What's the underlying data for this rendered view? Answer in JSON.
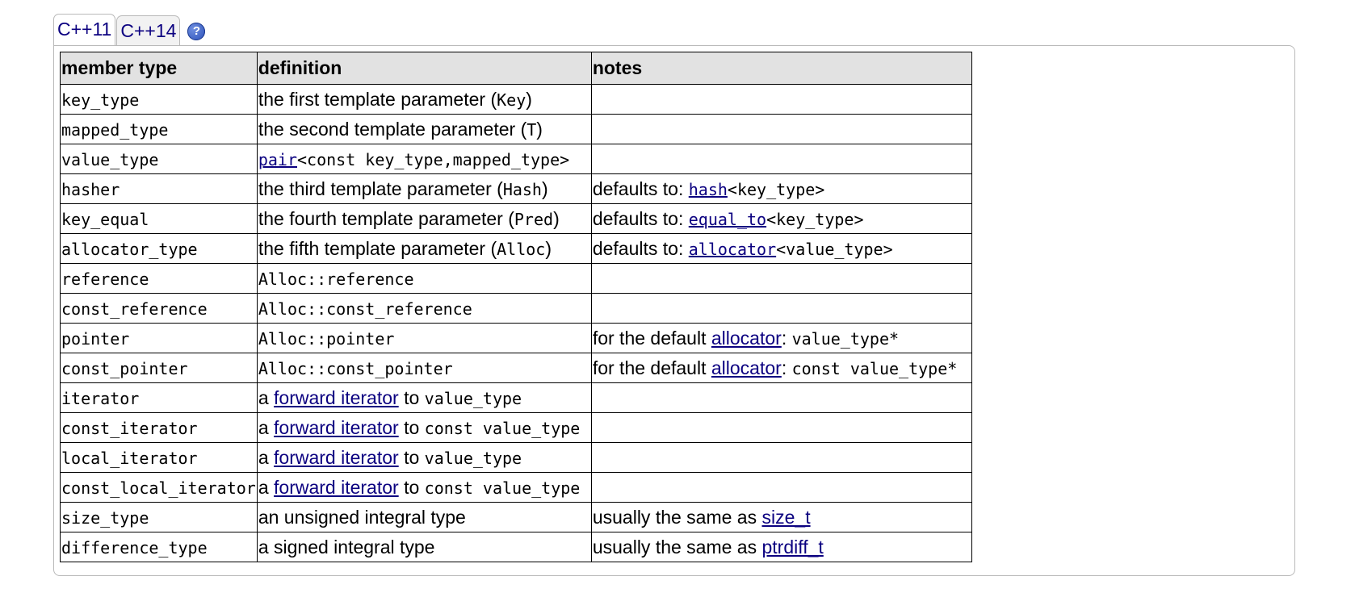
{
  "tabs": [
    {
      "label": "C++11",
      "active": true
    },
    {
      "label": "C++14",
      "active": false
    }
  ],
  "help_icon": {
    "glyph": "?",
    "name": "help-icon"
  },
  "table": {
    "headers": [
      "member type",
      "definition",
      "notes"
    ],
    "rows": [
      {
        "member": "key_type",
        "definition": [
          {
            "t": "text",
            "v": "the first template parameter ("
          },
          {
            "t": "code",
            "v": "Key"
          },
          {
            "t": "text",
            "v": ")"
          }
        ],
        "notes": []
      },
      {
        "member": "mapped_type",
        "definition": [
          {
            "t": "text",
            "v": "the second template parameter ("
          },
          {
            "t": "code",
            "v": "T"
          },
          {
            "t": "text",
            "v": ")"
          }
        ],
        "notes": []
      },
      {
        "member": "value_type",
        "definition": [
          {
            "t": "codelink",
            "v": "pair"
          },
          {
            "t": "code",
            "v": "<const key_type,mapped_type>"
          }
        ],
        "notes": []
      },
      {
        "member": "hasher",
        "definition": [
          {
            "t": "text",
            "v": "the third template parameter ("
          },
          {
            "t": "code",
            "v": "Hash"
          },
          {
            "t": "text",
            "v": ")"
          }
        ],
        "notes": [
          {
            "t": "text",
            "v": "defaults to: "
          },
          {
            "t": "codelink",
            "v": "hash"
          },
          {
            "t": "code",
            "v": "<key_type>"
          }
        ]
      },
      {
        "member": "key_equal",
        "definition": [
          {
            "t": "text",
            "v": "the fourth template parameter ("
          },
          {
            "t": "code",
            "v": "Pred"
          },
          {
            "t": "text",
            "v": ")"
          }
        ],
        "notes": [
          {
            "t": "text",
            "v": "defaults to: "
          },
          {
            "t": "codelink",
            "v": "equal_to"
          },
          {
            "t": "code",
            "v": "<key_type>"
          }
        ]
      },
      {
        "member": "allocator_type",
        "definition": [
          {
            "t": "text",
            "v": "the fifth template parameter ("
          },
          {
            "t": "code",
            "v": "Alloc"
          },
          {
            "t": "text",
            "v": ")"
          }
        ],
        "notes": [
          {
            "t": "text",
            "v": "defaults to: "
          },
          {
            "t": "codelink",
            "v": "allocator"
          },
          {
            "t": "code",
            "v": "<value_type>"
          }
        ]
      },
      {
        "member": "reference",
        "definition": [
          {
            "t": "code",
            "v": "Alloc::reference"
          }
        ],
        "notes": []
      },
      {
        "member": "const_reference",
        "definition": [
          {
            "t": "code",
            "v": "Alloc::const_reference"
          }
        ],
        "notes": []
      },
      {
        "member": "pointer",
        "definition": [
          {
            "t": "code",
            "v": "Alloc::pointer"
          }
        ],
        "notes": [
          {
            "t": "text",
            "v": "for the default "
          },
          {
            "t": "link",
            "v": "allocator"
          },
          {
            "t": "text",
            "v": ": "
          },
          {
            "t": "code",
            "v": "value_type*"
          }
        ]
      },
      {
        "member": "const_pointer",
        "definition": [
          {
            "t": "code",
            "v": "Alloc::const_pointer"
          }
        ],
        "notes": [
          {
            "t": "text",
            "v": "for the default "
          },
          {
            "t": "link",
            "v": "allocator"
          },
          {
            "t": "text",
            "v": ": "
          },
          {
            "t": "code",
            "v": "const value_type*"
          }
        ]
      },
      {
        "member": "iterator",
        "definition": [
          {
            "t": "text",
            "v": "a "
          },
          {
            "t": "link",
            "v": "forward iterator"
          },
          {
            "t": "text",
            "v": " to "
          },
          {
            "t": "code",
            "v": "value_type"
          }
        ],
        "notes": []
      },
      {
        "member": "const_iterator",
        "definition": [
          {
            "t": "text",
            "v": "a "
          },
          {
            "t": "link",
            "v": "forward iterator"
          },
          {
            "t": "text",
            "v": " to "
          },
          {
            "t": "code",
            "v": "const value_type"
          }
        ],
        "notes": []
      },
      {
        "member": "local_iterator",
        "definition": [
          {
            "t": "text",
            "v": "a "
          },
          {
            "t": "link",
            "v": "forward iterator"
          },
          {
            "t": "text",
            "v": " to "
          },
          {
            "t": "code",
            "v": "value_type"
          }
        ],
        "notes": []
      },
      {
        "member": "const_local_iterator",
        "definition": [
          {
            "t": "text",
            "v": "a "
          },
          {
            "t": "link",
            "v": "forward iterator"
          },
          {
            "t": "text",
            "v": " to "
          },
          {
            "t": "code",
            "v": "const value_type"
          }
        ],
        "notes": []
      },
      {
        "member": "size_type",
        "definition": [
          {
            "t": "text",
            "v": "an unsigned integral type"
          }
        ],
        "notes": [
          {
            "t": "text",
            "v": "usually the same as "
          },
          {
            "t": "link",
            "v": "size_t"
          }
        ]
      },
      {
        "member": "difference_type",
        "definition": [
          {
            "t": "text",
            "v": "a signed integral type"
          }
        ],
        "notes": [
          {
            "t": "text",
            "v": "usually the same as "
          },
          {
            "t": "link",
            "v": "ptrdiff_t"
          }
        ]
      }
    ]
  },
  "colors": {
    "link": "#0b0080",
    "header_bg": "#e2e2e2",
    "panel_border": "#b9b9b9",
    "help_icon": "#2a4fb8"
  }
}
